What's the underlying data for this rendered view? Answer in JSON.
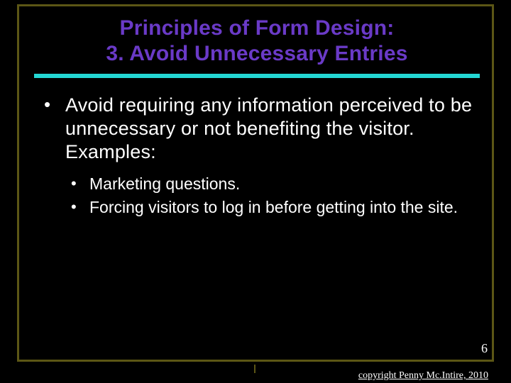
{
  "title": {
    "line1": "Principles of Form Design:",
    "line2": "3. Avoid Unnecessary Entries"
  },
  "bullets": {
    "main": "Avoid requiring any information perceived to be unnecessary or not benefiting the visitor. Examples:",
    "sub1": "Marketing questions.",
    "sub2": "Forcing visitors to log in before getting into the site."
  },
  "page_number": "6",
  "copyright": "copyright Penny Mc.Intire, 2010"
}
